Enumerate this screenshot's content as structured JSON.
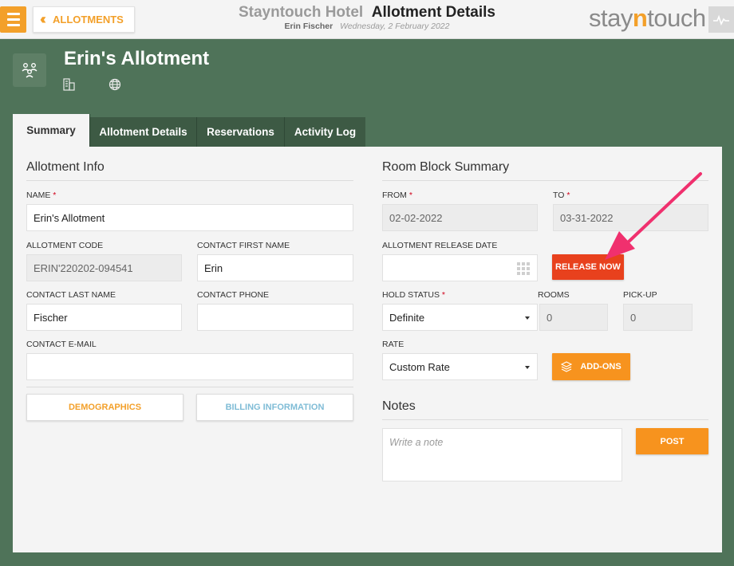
{
  "header": {
    "back_label": "ALLOTMENTS",
    "hotel_name": "Stayntouch Hotel",
    "page_title": "Allotment Details",
    "user_name": "Erin Fischer",
    "date": "Wednesday, 2 February 2022",
    "logo_left": "stay",
    "logo_n": "n",
    "logo_right": "touch"
  },
  "allotment": {
    "title": "Erin's Allotment"
  },
  "tabs": [
    {
      "label": "Summary",
      "active": true
    },
    {
      "label": "Allotment Details"
    },
    {
      "label": "Reservations"
    },
    {
      "label": "Activity Log"
    }
  ],
  "info": {
    "section_title": "Allotment Info",
    "name_label": "NAME",
    "name_value": "Erin's Allotment",
    "code_label": "ALLOTMENT CODE",
    "code_value": "ERIN'220202-094541",
    "first_name_label": "CONTACT FIRST NAME",
    "first_name_value": "Erin",
    "last_name_label": "CONTACT LAST NAME",
    "last_name_value": "Fischer",
    "phone_label": "CONTACT PHONE",
    "phone_value": "",
    "email_label": "CONTACT E-MAIL",
    "email_value": "",
    "demographics_label": "DEMOGRAPHICS",
    "billing_label": "BILLING INFORMATION"
  },
  "room_block": {
    "section_title": "Room Block Summary",
    "from_label": "FROM",
    "from_value": "02-02-2022",
    "to_label": "TO",
    "to_value": "03-31-2022",
    "release_date_label": "ALLOTMENT RELEASE DATE",
    "release_date_value": "",
    "release_now_label": "RELEASE NOW",
    "hold_status_label": "HOLD STATUS",
    "hold_status_value": "Definite",
    "rooms_label": "ROOMS",
    "rooms_value": "0",
    "pickup_label": "PICK-UP",
    "pickup_value": "0",
    "rate_label": "RATE",
    "rate_value": "Custom Rate",
    "addons_label": "ADD-ONS"
  },
  "notes": {
    "section_title": "Notes",
    "placeholder": "Write a note",
    "post_label": "POST"
  },
  "colors": {
    "accent_orange": "#f3a02a",
    "background_green": "#4f7359",
    "release_red": "#e8411d",
    "annotation_pink": "#f0306e",
    "billing_blue": "#7fbcd6"
  }
}
